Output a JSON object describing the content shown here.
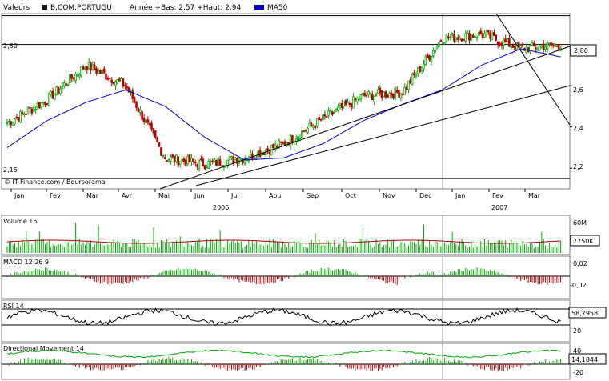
{
  "header": {
    "left_label": "Valeurs",
    "symbol": "B.COM.PORTUGU",
    "year_info": "Année +Bas: 2,57 +Haut: 2,94",
    "ma_label": "MA50"
  },
  "credit": "© IT-Finance.com / Boursorama",
  "colors": {
    "up": "#00aa00",
    "down": "#bb0000",
    "ma": "#0000cc",
    "grid": "#000000",
    "dm_plus": "#00aa00",
    "dm_minus": "#bb0000",
    "volume_ma": "#aa0000"
  },
  "chart_data": [
    {
      "type": "candlestick",
      "name": "price",
      "title": "",
      "x_months": [
        "Jan",
        "Fev",
        "Mar",
        "Avr",
        "Mai",
        "Jun",
        "Jul",
        "Aou",
        "Sep",
        "Oct",
        "Nov",
        "Dec",
        "Jan",
        "Fev",
        "Mar"
      ],
      "year_labels": [
        "2006",
        "2007"
      ],
      "ylim": [
        2.1,
        2.95
      ],
      "y_ticks": [
        "2,2",
        "2,4",
        "2,6"
      ],
      "reference_lines": [
        {
          "label": "2,80",
          "value": 2.8
        },
        {
          "label": "2,15",
          "value": 2.15
        },
        {
          "label": "",
          "value": 2.94
        }
      ],
      "last_value_label": "2,80",
      "closes_monthly": [
        {
          "month": "Jan 2006",
          "close": 2.42
        },
        {
          "month": "Fev 2006",
          "close": 2.53
        },
        {
          "month": "Mar 2006",
          "close": 2.7
        },
        {
          "month": "Avr 2006",
          "close": 2.6
        },
        {
          "month": "Mai 2006",
          "close": 2.25
        },
        {
          "month": "Jun 2006",
          "close": 2.22
        },
        {
          "month": "Jul 2006",
          "close": 2.25
        },
        {
          "month": "Aou 2006",
          "close": 2.32
        },
        {
          "month": "Sep 2006",
          "close": 2.44
        },
        {
          "month": "Oct 2006",
          "close": 2.55
        },
        {
          "month": "Nov 2006",
          "close": 2.57
        },
        {
          "month": "Dec 2006",
          "close": 2.83
        },
        {
          "month": "Jan 2007",
          "close": 2.85
        },
        {
          "month": "Fev 2007",
          "close": 2.78
        },
        {
          "month": "Mar 2007",
          "close": 2.8
        }
      ],
      "ma50_monthly": [
        2.3,
        2.43,
        2.52,
        2.58,
        2.5,
        2.35,
        2.24,
        2.25,
        2.32,
        2.43,
        2.51,
        2.58,
        2.7,
        2.78,
        2.74
      ]
    },
    {
      "type": "bar",
      "name": "volume",
      "title": "Volume 15",
      "y_ticks": [
        "60M"
      ],
      "last_value_label": "7750K"
    },
    {
      "type": "bar",
      "name": "macd",
      "title": "MACD 12 26 9",
      "y_ticks": [
        "0,02",
        "-0,02"
      ]
    },
    {
      "type": "line",
      "name": "rsi",
      "title": "RSI 14",
      "y_ticks": [
        "20"
      ],
      "last_value_label": "58,7958"
    },
    {
      "type": "line",
      "name": "dm",
      "title": "Directional Movement 14",
      "y_ticks": [
        "40",
        "-20"
      ],
      "last_value_label": "14,1844"
    }
  ]
}
